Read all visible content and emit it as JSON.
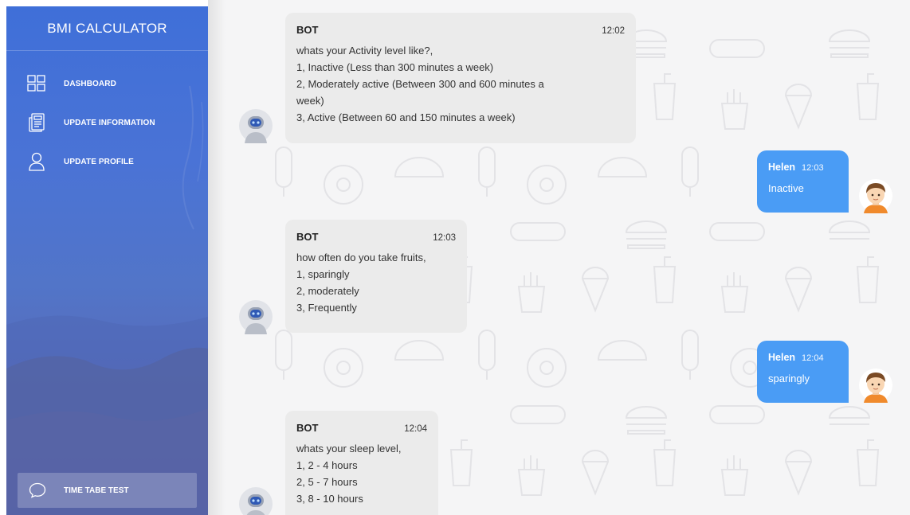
{
  "sidebar": {
    "title": "BMI CALCULATOR",
    "nav": [
      {
        "label": "DASHBOARD",
        "icon": "dashboard-grid-icon"
      },
      {
        "label": "UPDATE INFORMATION",
        "icon": "document-icon"
      },
      {
        "label": "UPDATE PROFILE",
        "icon": "user-icon"
      }
    ],
    "bottom_button": {
      "label": "TIME TABE TEST",
      "icon": "chat-bubble-icon"
    }
  },
  "colors": {
    "sidebar_blue": "#4a73d6",
    "user_bubble": "#4a9cf5",
    "bot_bubble": "#ebebeb",
    "chat_background": "#f5f5f6"
  },
  "messages": [
    {
      "sender": "BOT",
      "time": "12:02",
      "lines": [
        "whats your Activity level like?,",
        "1, Inactive (Less than 300 minutes a week)",
        "2, Moderately active (Between 300 and 600 minutes a",
        "week)",
        "3, Active (Between 60 and 150 minutes a week)"
      ]
    },
    {
      "sender": "Helen",
      "time": "12:03",
      "text": "Inactive"
    },
    {
      "sender": "BOT",
      "time": "12:03",
      "lines": [
        "how often do you take fruits,",
        "1, sparingly",
        "2, moderately",
        "3, Frequently"
      ]
    },
    {
      "sender": "Helen",
      "time": "12:04",
      "text": "sparingly"
    },
    {
      "sender": "BOT",
      "time": "12:04",
      "lines": [
        "whats your sleep level,",
        "1, 2 - 4 hours",
        "2, 5 - 7 hours",
        "3, 8 - 10 hours"
      ]
    }
  ]
}
